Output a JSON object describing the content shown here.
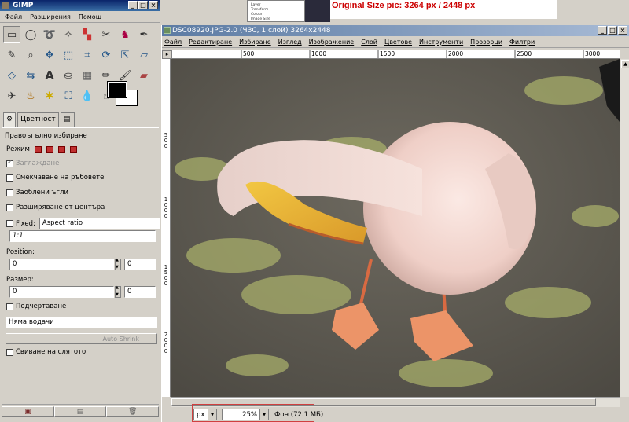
{
  "toolbox": {
    "title": "GIMP",
    "menu": [
      "Файл",
      "Разширения",
      "Помощ"
    ],
    "tab_label": "Цветност",
    "tool_name": "Правоъгълно избиране",
    "mode_label": "Режим:",
    "options": {
      "antialias": "Заглаждане",
      "feather": "Смекчаване на ръбовете",
      "rounded": "Заоблени ъгли",
      "expand_center": "Разширяване от центъра",
      "fixed_label": "Fixed:",
      "fixed_value": "Aspect ratio",
      "ratio_value": "1:1",
      "position_label": "Position:",
      "position_x": "0",
      "position_y": "0",
      "size_label": "Размер:",
      "size_w": "0",
      "size_h": "0",
      "highlight": "Подчертаване",
      "guides_value": "Няма водачи",
      "auto_shrink": "Auto Shrink",
      "shrink_merged": "Свиване на слятото"
    }
  },
  "mini_menu": [
    "Layer",
    "Transform",
    "Colour",
    "Image Size"
  ],
  "banner": {
    "text": "Original Size pic: 3264 px / 2448 px",
    "color": "#cc0000"
  },
  "image_window": {
    "title": "DSC08920.JPG-2.0 (ЧЗС, 1 слой) 3264x2448",
    "menu": [
      "Файл",
      "Редактиране",
      "Избиране",
      "Изглед",
      "Изображение",
      "Слой",
      "Цветове",
      "Инструменти",
      "Прозорци",
      "Филтри"
    ],
    "ruler_h": [
      "500",
      "1000",
      "1500",
      "2000",
      "2500",
      "3000"
    ],
    "ruler_v": [
      "500",
      "1000",
      "1500",
      "2000"
    ],
    "status": {
      "unit": "px",
      "zoom": "25%",
      "info": "Фон (72.1 MБ)"
    }
  }
}
